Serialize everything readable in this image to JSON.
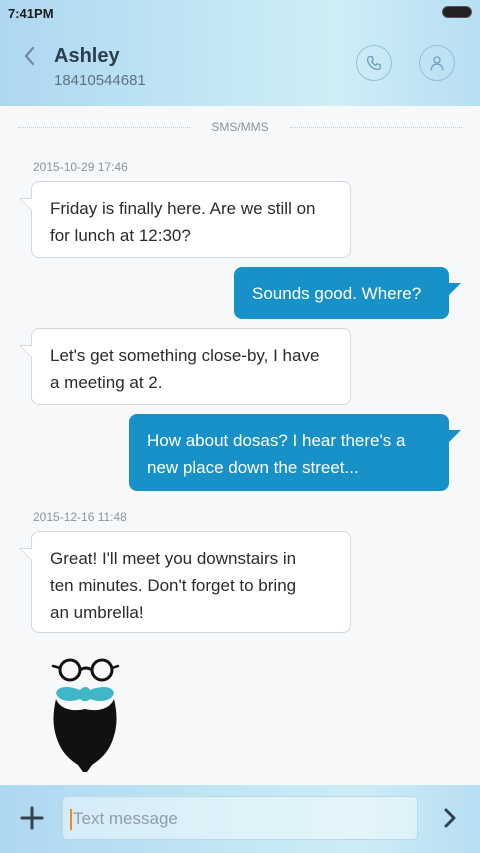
{
  "status_bar": {
    "time": "7:41PM"
  },
  "header": {
    "name": "Ashley",
    "number": "18410544681"
  },
  "channel_label": "SMS/MMS",
  "messages": [
    {
      "timestamp": "2015-10-29 17:46",
      "direction": "incoming",
      "lines": [
        "Friday is finally here. Are we still on",
        "for lunch at 12:30?"
      ]
    },
    {
      "direction": "outgoing",
      "lines": [
        "Sounds good. Where?"
      ]
    },
    {
      "direction": "incoming",
      "lines": [
        "Let's get something close-by, I have",
        "a meeting at 2."
      ]
    },
    {
      "direction": "outgoing",
      "lines": [
        "How about dosas? I hear there's a",
        "new place down the street..."
      ]
    },
    {
      "timestamp": "2015-12-16 11:48",
      "direction": "incoming",
      "lines": [
        "Great! I'll meet you downstairs in",
        "ten minutes. Don't forget to bring",
        "an umbrella!"
      ]
    },
    {
      "direction": "incoming",
      "sticker": "glasses-beard-mustache-sticker"
    }
  ],
  "composer": {
    "placeholder": "Text message"
  },
  "colors": {
    "outgoing_bubble": "#1791c8",
    "incoming_bubble": "#ffffff",
    "header_gradient_start": "#aed7f1",
    "header_gradient_end": "#cfeef6",
    "caret": "#f08a1e",
    "mustache": "#3fb7c6"
  },
  "icons": {
    "back": "chevron-left-icon",
    "call": "phone-icon",
    "contact": "person-icon",
    "attach": "plus-icon",
    "send": "chevron-right-icon"
  }
}
